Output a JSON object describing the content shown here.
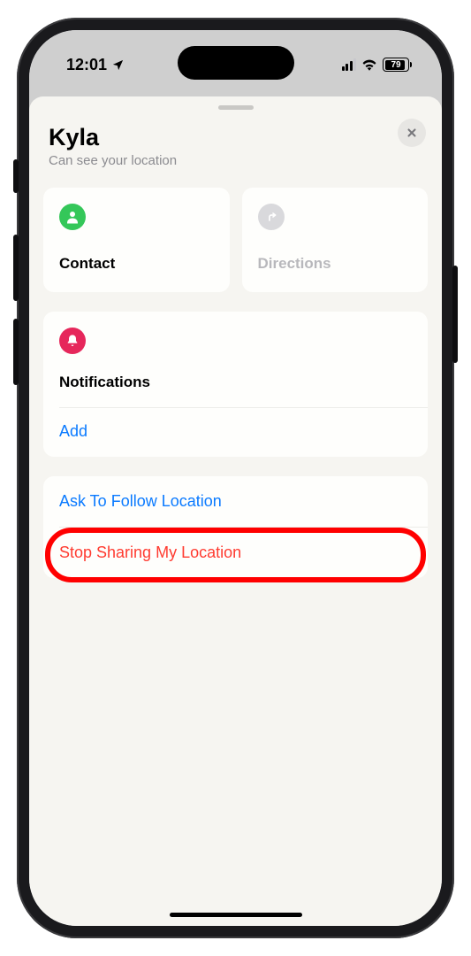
{
  "status": {
    "time": "12:01",
    "battery_pct": "79"
  },
  "sheet": {
    "title": "Kyla",
    "subtitle": "Can see your location"
  },
  "cards": {
    "contact_label": "Contact",
    "directions_label": "Directions",
    "notifications_label": "Notifications",
    "add_label": "Add"
  },
  "actions": {
    "ask_follow": "Ask To Follow Location",
    "stop_sharing": "Stop Sharing My Location"
  }
}
